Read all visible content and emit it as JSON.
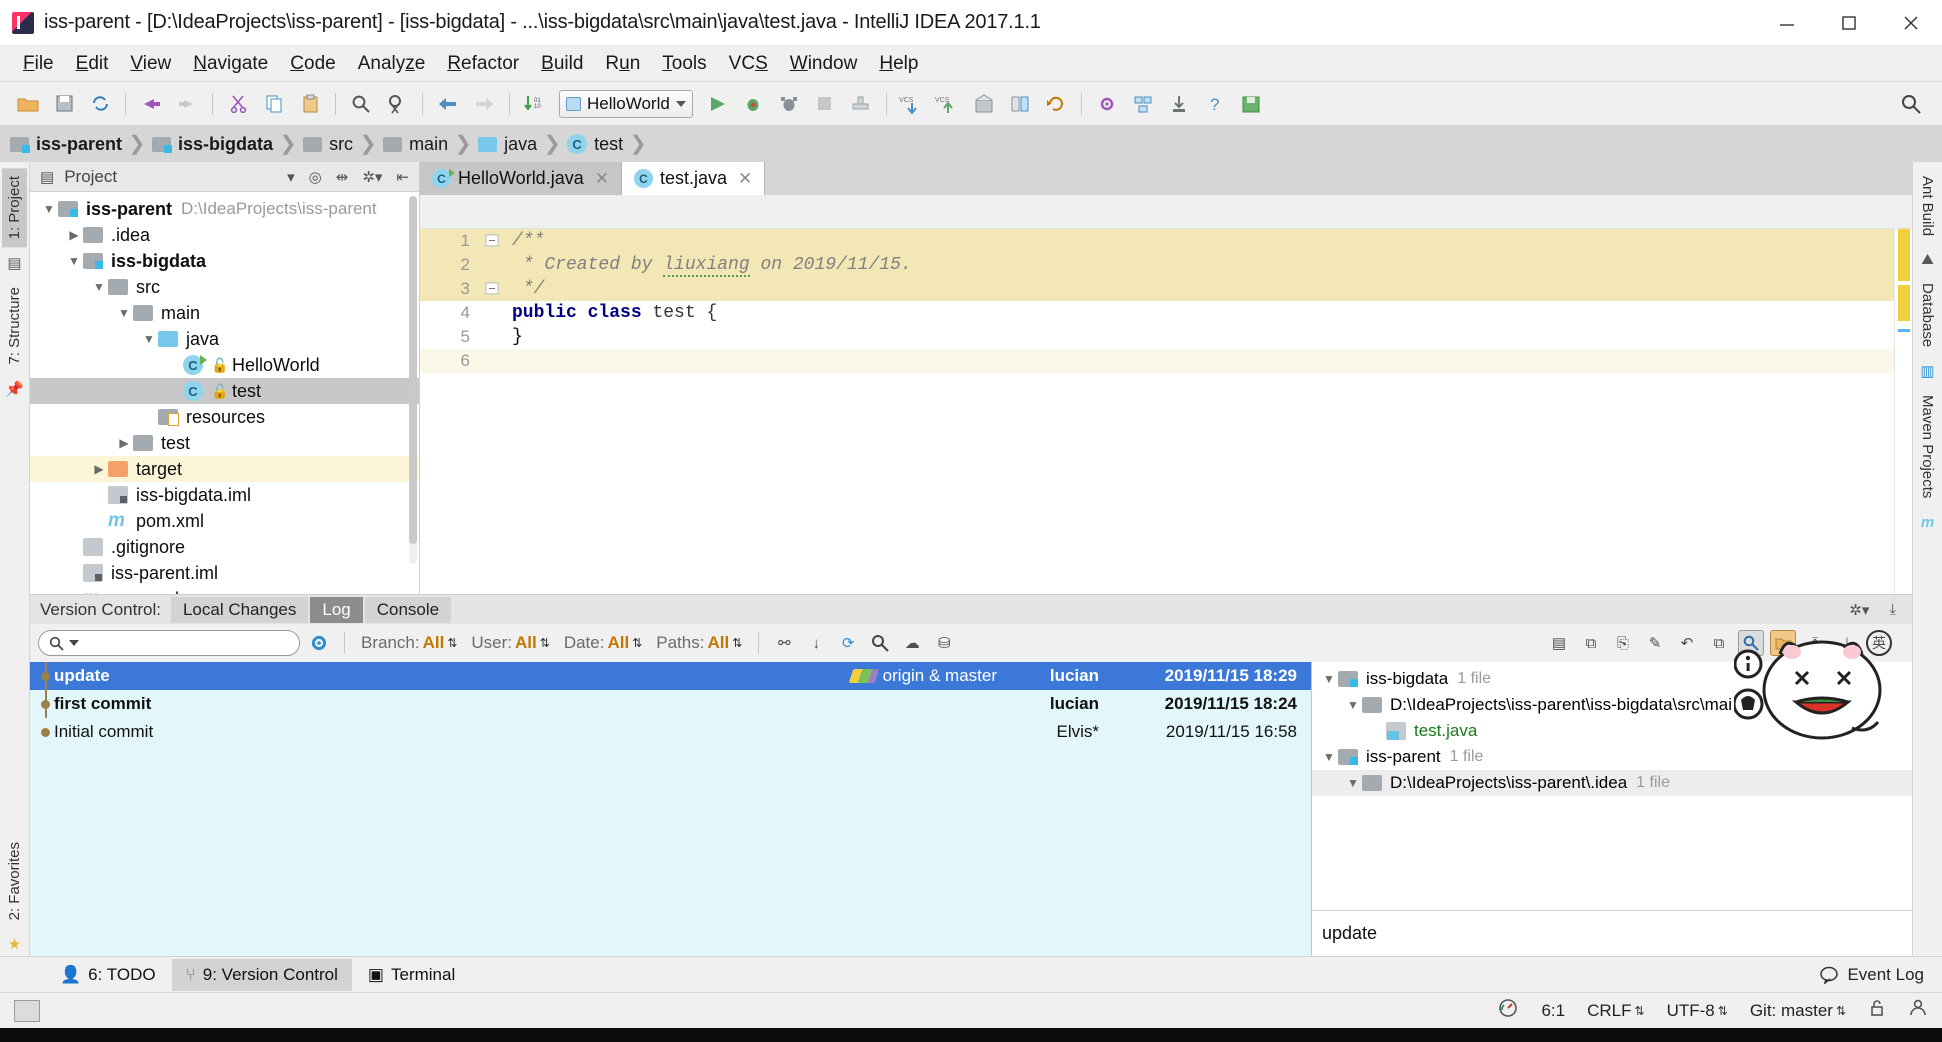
{
  "window": {
    "title": "iss-parent - [D:\\IdeaProjects\\iss-parent] - [iss-bigdata] - ...\\iss-bigdata\\src\\main\\java\\test.java - IntelliJ IDEA 2017.1.1",
    "minimize": "minimize-icon",
    "maximize": "maximize-icon",
    "close": "close-icon"
  },
  "menubar": {
    "items": [
      "File",
      "Edit",
      "View",
      "Navigate",
      "Code",
      "Analyze",
      "Refactor",
      "Build",
      "Run",
      "Tools",
      "VCS",
      "Window",
      "Help"
    ]
  },
  "toolbar": {
    "run_config": "HelloWorld",
    "icons": [
      "open-folder-icon",
      "save-all-icon",
      "sync-icon",
      "undo-icon",
      "redo-icon",
      "cut-icon",
      "copy-icon",
      "paste-icon",
      "find-icon",
      "replace-icon",
      "back-icon",
      "forward-icon",
      "compile-icon"
    ],
    "right_icons": [
      "run-icon",
      "debug-icon",
      "coverage-icon",
      "stop-icon",
      "build-icon",
      "vcs-update-icon",
      "vcs-commit-icon",
      "history-icon",
      "diff-icon",
      "rollback-icon",
      "settings-icon",
      "structure-icon",
      "download-icon",
      "help-icon",
      "save-icon"
    ],
    "search_everywhere": "search-icon"
  },
  "breadcrumb": {
    "items": [
      {
        "label": "iss-parent",
        "icon": "module-folder-icon",
        "bold": true
      },
      {
        "label": "iss-bigdata",
        "icon": "module-folder-icon",
        "bold": true
      },
      {
        "label": "src",
        "icon": "folder-icon",
        "bold": false
      },
      {
        "label": "main",
        "icon": "folder-icon",
        "bold": false
      },
      {
        "label": "java",
        "icon": "source-folder-icon",
        "bold": false
      },
      {
        "label": "test",
        "icon": "class-icon",
        "bold": false
      }
    ]
  },
  "left_rail": {
    "tabs": [
      "1: Project",
      "7: Structure"
    ],
    "bottom_tab": "2: Favorites"
  },
  "right_rail": {
    "tabs": [
      "Ant Build",
      "Database",
      "Maven Projects"
    ]
  },
  "project_panel": {
    "header_title": "Project",
    "header_icons": [
      "project-view-icon",
      "chevron-down-icon",
      "locate-icon",
      "collapse-all-icon",
      "settings-icon",
      "hide-icon"
    ],
    "tree": [
      {
        "label": "iss-parent",
        "path": "D:\\IdeaProjects\\iss-parent",
        "indent": 0,
        "arrow": "down",
        "icon": "module-folder-icon",
        "bold": true,
        "state": "none"
      },
      {
        "label": ".idea",
        "path": "",
        "indent": 1,
        "arrow": "right",
        "icon": "folder-icon",
        "bold": false,
        "state": "none"
      },
      {
        "label": "iss-bigdata",
        "path": "",
        "indent": 1,
        "arrow": "down",
        "icon": "module-folder-icon",
        "bold": true,
        "state": "none"
      },
      {
        "label": "src",
        "path": "",
        "indent": 2,
        "arrow": "down",
        "icon": "folder-icon",
        "bold": false,
        "state": "none"
      },
      {
        "label": "main",
        "path": "",
        "indent": 3,
        "arrow": "down",
        "icon": "folder-icon",
        "bold": false,
        "state": "none"
      },
      {
        "label": "java",
        "path": "",
        "indent": 4,
        "arrow": "down",
        "icon": "source-folder-icon",
        "bold": false,
        "state": "none"
      },
      {
        "label": "HelloWorld",
        "path": "",
        "indent": 5,
        "arrow": "none",
        "icon": "runnable-class-icon",
        "bold": false,
        "state": "none"
      },
      {
        "label": "test",
        "path": "",
        "indent": 5,
        "arrow": "none",
        "icon": "class-icon",
        "bold": false,
        "state": "selected"
      },
      {
        "label": "resources",
        "path": "",
        "indent": 4,
        "arrow": "none",
        "icon": "resources-folder-icon",
        "bold": false,
        "state": "none"
      },
      {
        "label": "test",
        "path": "",
        "indent": 3,
        "arrow": "right",
        "icon": "folder-icon",
        "bold": false,
        "state": "none"
      },
      {
        "label": "target",
        "path": "",
        "indent": 2,
        "arrow": "right",
        "icon": "excluded-folder-icon",
        "bold": false,
        "state": "highlight"
      },
      {
        "label": "iss-bigdata.iml",
        "path": "",
        "indent": 2,
        "arrow": "none",
        "icon": "iml-file-icon",
        "bold": false,
        "state": "none"
      },
      {
        "label": "pom.xml",
        "path": "",
        "indent": 2,
        "arrow": "none",
        "icon": "maven-file-icon",
        "bold": false,
        "state": "none"
      },
      {
        "label": ".gitignore",
        "path": "",
        "indent": 1,
        "arrow": "none",
        "icon": "text-file-icon",
        "bold": false,
        "state": "none"
      },
      {
        "label": "iss-parent.iml",
        "path": "",
        "indent": 1,
        "arrow": "none",
        "icon": "iml-file-icon",
        "bold": false,
        "state": "none"
      },
      {
        "label": "pom.xml",
        "path": "",
        "indent": 1,
        "arrow": "none",
        "icon": "maven-file-icon",
        "bold": false,
        "state": "none"
      }
    ]
  },
  "editor": {
    "tabs": [
      {
        "label": "HelloWorld.java",
        "icon": "runnable-class-icon",
        "active": false
      },
      {
        "label": "test.java",
        "icon": "class-icon",
        "active": true
      }
    ],
    "lines": [
      {
        "num": "1",
        "text": "/**",
        "kind": "comment",
        "highlight": true,
        "fold": "start"
      },
      {
        "num": "2",
        "text": " * Created by liuxiang on 2019/11/15.",
        "kind": "comment",
        "highlight": true,
        "fold": "none"
      },
      {
        "num": "3",
        "text": " */",
        "kind": "comment",
        "highlight": true,
        "fold": "end"
      },
      {
        "num": "4",
        "text": "public class test {",
        "kind": "code",
        "highlight": false,
        "fold": "none"
      },
      {
        "num": "5",
        "text": "}",
        "kind": "code",
        "highlight": false,
        "fold": "none"
      },
      {
        "num": "6",
        "text": "",
        "kind": "code",
        "highlight": false,
        "fold": "none"
      }
    ]
  },
  "version_control": {
    "panel_label": "Version Control:",
    "tabs": [
      {
        "label": "Local Changes",
        "selected": false
      },
      {
        "label": "Log",
        "selected": true
      },
      {
        "label": "Console",
        "selected": false
      }
    ],
    "search_placeholder": "",
    "filters": [
      {
        "label": "Branch:",
        "value": "All"
      },
      {
        "label": "User:",
        "value": "All"
      },
      {
        "label": "Date:",
        "value": "All"
      },
      {
        "label": "Paths:",
        "value": "All"
      }
    ],
    "toolbar_icons": [
      "settings-icon",
      "intellisort-icon",
      "collapse-icon",
      "refresh-icon",
      "search-icon",
      "highlight-icon",
      "show-graph-icon"
    ],
    "right_toolbar_icons": [
      "commit-icon",
      "update-icon",
      "create-patch-icon",
      "annotate-icon",
      "revert-icon",
      "copy-revision-icon",
      "show-diff-icon",
      "open-repository-icon",
      "expand-all-icon",
      "collapse-all-icon",
      "ime-icon"
    ],
    "commits": [
      {
        "subject": "update",
        "tag": "origin & master",
        "author": "lucian",
        "date": "2019/11/15 18:29",
        "selected": true,
        "bold": true
      },
      {
        "subject": "first commit",
        "tag": "",
        "author": "lucian",
        "date": "2019/11/15 18:24",
        "selected": false,
        "bold": true
      },
      {
        "subject": "Initial commit",
        "tag": "",
        "author": "Elvis*",
        "date": "2019/11/15 16:58",
        "selected": false,
        "bold": false
      }
    ],
    "changed_files": [
      {
        "label": "iss-bigdata",
        "count": "1 file",
        "indent": 0,
        "arrow": "down",
        "icon": "module-folder-icon",
        "color": "normal",
        "highlight": false
      },
      {
        "label": "D:\\IdeaProjects\\iss-parent\\iss-bigdata\\src\\mai",
        "count": "",
        "indent": 1,
        "arrow": "down",
        "icon": "folder-icon",
        "color": "normal",
        "highlight": false
      },
      {
        "label": "test.java",
        "count": "",
        "indent": 2,
        "arrow": "none",
        "icon": "java-file-icon",
        "color": "green",
        "highlight": false
      },
      {
        "label": "iss-parent",
        "count": "1 file",
        "indent": 0,
        "arrow": "down",
        "icon": "module-folder-icon",
        "color": "normal",
        "highlight": false
      },
      {
        "label": "D:\\IdeaProjects\\iss-parent\\.idea",
        "count": "1 file",
        "indent": 1,
        "arrow": "down",
        "icon": "folder-icon",
        "color": "normal",
        "highlight": true
      }
    ],
    "commit_message": "update"
  },
  "bottom_tabs": [
    {
      "label": "6: TODO",
      "icon": "todo-icon",
      "selected": false
    },
    {
      "label": "9: Version Control",
      "icon": "vcs-icon",
      "selected": true
    },
    {
      "label": "Terminal",
      "icon": "terminal-icon",
      "selected": false
    }
  ],
  "event_log": "Event Log",
  "statusbar": {
    "caret": "6:1",
    "line_sep": "CRLF",
    "encoding": "UTF-8",
    "branch": "Git: master",
    "icons": [
      "memory-icon",
      "lock-icon",
      "inspector-icon"
    ]
  },
  "colors": {
    "accent_blue": "#3b78d8",
    "log_bg": "#e3f7fb",
    "highlight_yellow": "#f3e7b6",
    "tree_selected": "#c8c8c8"
  }
}
